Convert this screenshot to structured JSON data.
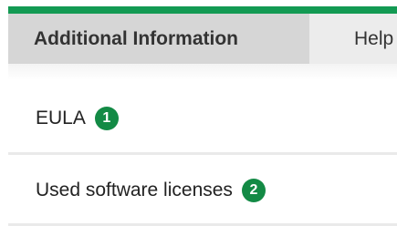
{
  "colors": {
    "accent_bar": "#139a53",
    "badge": "#138a45",
    "tab_active_bg": "#d6d6d6",
    "tab_strip_bg": "#ececec"
  },
  "tabs": {
    "active_label": "Additional Information",
    "help_label": "Help"
  },
  "items": [
    {
      "label": "EULA",
      "badge": "1"
    },
    {
      "label": "Used software licenses",
      "badge": "2"
    }
  ]
}
